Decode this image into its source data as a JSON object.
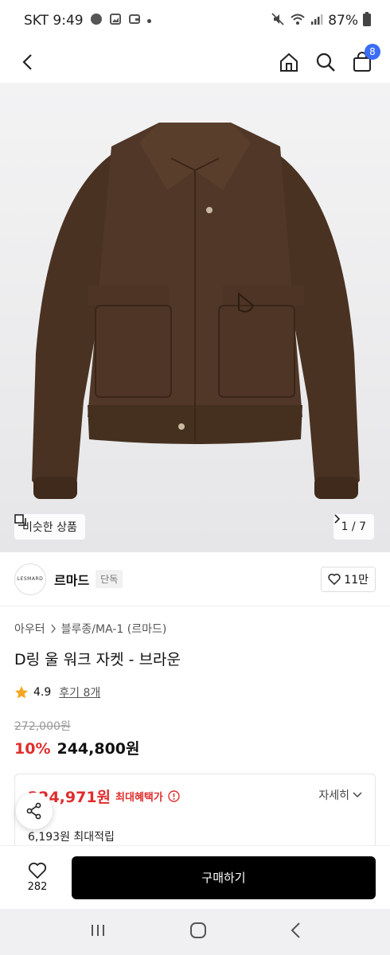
{
  "status": {
    "carrier_time": "SKT 9:49",
    "battery": "87%"
  },
  "header": {
    "cart_count": "8"
  },
  "gallery": {
    "similar_label": "비슷한 상품",
    "pager": "1 / 7"
  },
  "brand": {
    "logo_text": "LESMARD",
    "name": "르마드",
    "tag": "단독",
    "likes": "11만"
  },
  "product": {
    "breadcrumb_category": "아우터",
    "breadcrumb_sub": "블루종/MA-1 (르마드)",
    "title": "D링 울 워크 자켓 - 브라운",
    "rating": "4.9",
    "review_text": "후기 8개",
    "original_price": "272,000원",
    "discount": "10%",
    "price": "244,800원"
  },
  "benefit": {
    "max_price": "224,971원",
    "max_label": "최대혜택가",
    "detail_label": "자세히",
    "points": "6,193원 최대적립"
  },
  "bottom": {
    "wish_count": "282",
    "buy_label": "구매하기"
  },
  "colors": {
    "accent_red": "#e02d2d",
    "badge_blue": "#3b6cf6",
    "jacket_brown": "#4a3222"
  }
}
